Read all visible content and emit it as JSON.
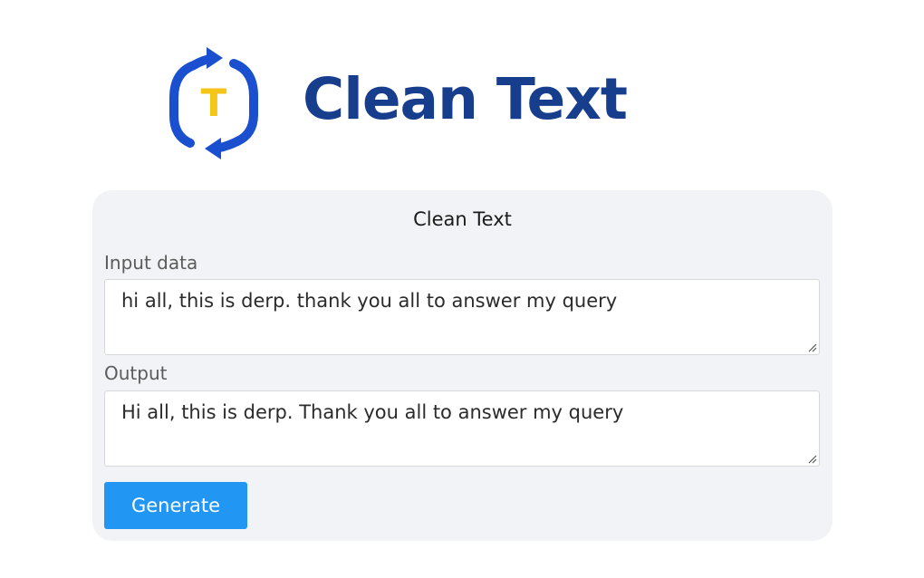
{
  "logo": {
    "icon": "refresh-arrows-letter-t-icon",
    "letter": "T",
    "title": "Clean Text",
    "colors": {
      "brand_blue": "#1a4fcf",
      "title_navy": "#163e8c",
      "letter_yellow": "#f5c518"
    }
  },
  "card": {
    "title": "Clean Text",
    "input": {
      "label": "Input data",
      "value": "hi all, this is derp. thank you all to answer my query"
    },
    "output": {
      "label": "Output",
      "value": "Hi all, this is derp. Thank you all to answer my query"
    },
    "generate_label": "Generate",
    "colors": {
      "card_background": "#f2f3f6",
      "button_blue": "#2196f3"
    }
  }
}
